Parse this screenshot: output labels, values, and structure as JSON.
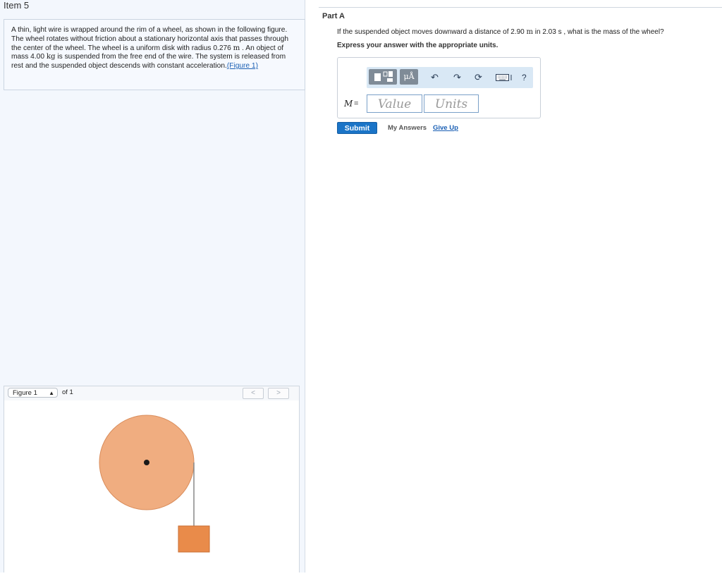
{
  "item": {
    "title": "Item 5"
  },
  "problem": {
    "seg1": "A thin, light wire is wrapped around the rim of a wheel, as shown in the following figure. The wheel rotates without friction about a stationary horizontal axis that passes through the center of the wheel. The wheel is a uniform disk with radius 0.276 ",
    "unit_m": "m",
    "seg2": " . An object of mass 4.00 ",
    "unit_kg": "kg",
    "seg3": " is suspended from the free end of the wire. The system is released from rest and the suspended object descends with constant acceleration.",
    "figure_link": "(Figure 1)"
  },
  "figure_nav": {
    "selected": "Figure 1",
    "of_label": "of 1",
    "prev": "<",
    "next": ">"
  },
  "part": {
    "title": "Part A",
    "q_seg1": "If the suspended object moves downward a distance of 2.90 ",
    "q_unit_m": "m",
    "q_seg2": " in 2.03 s , what is the mass of the wheel?",
    "instruction": "Express your answer with the appropriate units."
  },
  "answer": {
    "variable": "M",
    "equals": "=",
    "value_placeholder": "Value",
    "units_placeholder": "Units",
    "units_tool_label": "μÅ",
    "help": "?"
  },
  "actions": {
    "submit": "Submit",
    "my_answers": "My Answers",
    "give_up": "Give Up"
  },
  "colors": {
    "wheel": "#f0ad80",
    "block": "#e98b4a",
    "accent": "#1a74c7"
  }
}
